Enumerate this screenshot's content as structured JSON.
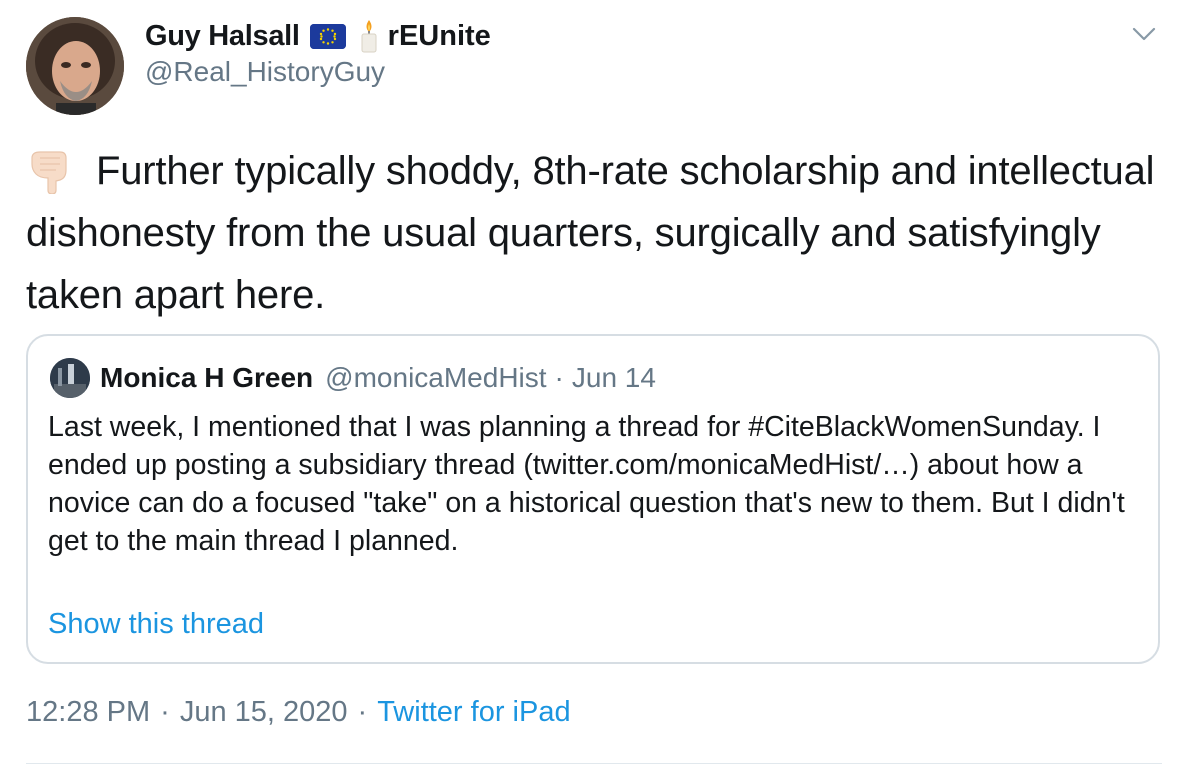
{
  "author": {
    "display_name": "Guy Halsall",
    "name_suffix": "rEUnite",
    "handle": "@Real_HistoryGuy",
    "flag_icon": "eu-flag-icon",
    "candle_icon": "candle-icon"
  },
  "tweet": {
    "lead_icon": "backhand-index-pointing-down-icon",
    "text": "Further typically shoddy, 8th-rate scholarship and intellectual dishonesty from the usual quarters, surgically and satisfyingly taken apart here."
  },
  "quoted": {
    "name": "Monica H Green",
    "handle": "@monicaMedHist",
    "separator": "·",
    "date": "Jun 14",
    "text": "Last week, I mentioned that I was planning a thread for #CiteBlackWomenSunday. I ended up posting a subsidiary thread (twitter.com/monicaMedHist/…) about how a novice can do a focused \"take\" on a historical question that's new to them. But I didn't get to the main thread I planned.",
    "show_thread_label": "Show this thread"
  },
  "footer": {
    "time": "12:28 PM",
    "dot1": "·",
    "date": "Jun 15, 2020",
    "dot2": "·",
    "source": "Twitter for iPad"
  },
  "colors": {
    "text": "#14171a",
    "muted": "#657786",
    "link": "#1b95e0",
    "border": "#d6dde3"
  }
}
